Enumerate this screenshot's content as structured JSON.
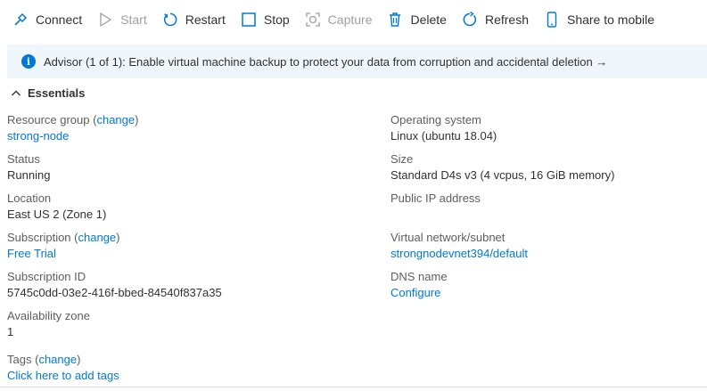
{
  "toolbar": {
    "connect": "Connect",
    "start": "Start",
    "restart": "Restart",
    "stop": "Stop",
    "capture": "Capture",
    "delete": "Delete",
    "refresh": "Refresh",
    "share": "Share to mobile"
  },
  "advisor": {
    "message": "Advisor (1 of 1): Enable virtual machine backup to protect your data from corruption and accidental deletion →"
  },
  "essentials": {
    "title": "Essentials",
    "change_label": "change",
    "left": {
      "resource_group_label": "Resource group",
      "resource_group_value": "strong-node",
      "status_label": "Status",
      "status_value": "Running",
      "location_label": "Location",
      "location_value": "East US 2 (Zone 1)",
      "subscription_label": "Subscription",
      "subscription_value": "Free Trial",
      "subscription_id_label": "Subscription ID",
      "subscription_id_value": "5745c0dd-03e2-416f-bbed-84540f837a35",
      "availability_zone_label": "Availability zone",
      "availability_zone_value": "1",
      "tags_label": "Tags",
      "tags_value": "Click here to add tags"
    },
    "right": {
      "os_label": "Operating system",
      "os_value": "Linux (ubuntu 18.04)",
      "size_label": "Size",
      "size_value": "Standard D4s v3 (4 vcpus, 16 GiB memory)",
      "public_ip_label": "Public IP address",
      "vnet_label": "Virtual network/subnet",
      "vnet_value": "strongnodevnet394/default",
      "dns_label": "DNS name",
      "dns_value": "Configure"
    }
  },
  "colors": {
    "accent": "#0078d4",
    "banner_bg": "#eff6fc",
    "disabled": "#a19f9d"
  },
  "icons": [
    "connect-icon",
    "start-icon",
    "restart-icon",
    "stop-icon",
    "capture-icon",
    "delete-icon",
    "refresh-icon",
    "mobile-icon",
    "info-icon",
    "chevron-up-icon"
  ]
}
